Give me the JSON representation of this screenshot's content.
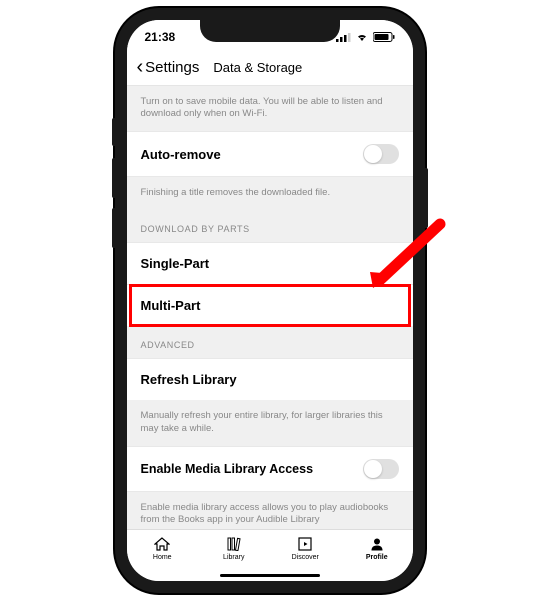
{
  "status": {
    "time": "21:38"
  },
  "header": {
    "back_label": "Settings",
    "title": "Data & Storage"
  },
  "content": {
    "mobile_data_info": "Turn on to save mobile data. You will be able to listen and download only when on Wi-Fi.",
    "auto_remove": {
      "label": "Auto-remove",
      "desc": "Finishing a title removes the downloaded file."
    },
    "download_parts": {
      "header": "DOWNLOAD BY PARTS",
      "single": "Single-Part",
      "multi": "Multi-Part"
    },
    "advanced": {
      "header": "ADVANCED",
      "refresh": "Refresh Library",
      "refresh_desc": "Manually refresh your entire library, for larger libraries this may take a while.",
      "media_access": "Enable Media Library Access",
      "media_access_desc": "Enable media library access allows you to play audiobooks from the Books app in your Audible Library"
    }
  },
  "tabs": {
    "home": "Home",
    "library": "Library",
    "discover": "Discover",
    "profile": "Profile"
  }
}
